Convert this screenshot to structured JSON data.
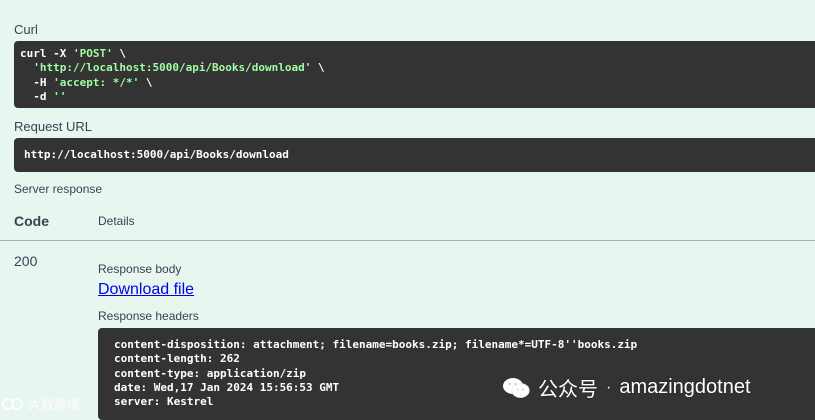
{
  "curl_section": {
    "label": "Curl",
    "lines": [
      {
        "pre": "curl -X ",
        "str": "'POST'",
        "post": " \\"
      },
      {
        "pre": "  ",
        "str": "'http://localhost:5000/api/Books/download'",
        "post": " \\"
      },
      {
        "pre": "  -H ",
        "str": "'accept: */*'",
        "post": " \\"
      },
      {
        "pre": "  -d ",
        "str": "''",
        "post": ""
      }
    ]
  },
  "request_url": {
    "label": "Request URL",
    "value": "http://localhost:5000/api/Books/download"
  },
  "server_response": {
    "label": "Server response",
    "col_code": "Code",
    "col_details": "Details",
    "status_code": "200",
    "response_body_label": "Response body",
    "download_link": "Download file",
    "response_headers_label": "Response headers",
    "headers": [
      "content-disposition: attachment; filename=books.zip; filename*=UTF-8''books.zip",
      "content-length: 262",
      "content-type: application/zip",
      "date: Wed,17 Jan 2024 15:56:53 GMT",
      "server: Kestrel"
    ]
  },
  "watermarks": {
    "left": "大数跨境",
    "right_prefix": "公众号",
    "right_sep": "·",
    "right_name": "amazingdotnet"
  },
  "colors": {
    "background": "#e8f6f0",
    "code_bg": "#333333",
    "string_green": "#a2fca2",
    "link": "#0000ee"
  }
}
